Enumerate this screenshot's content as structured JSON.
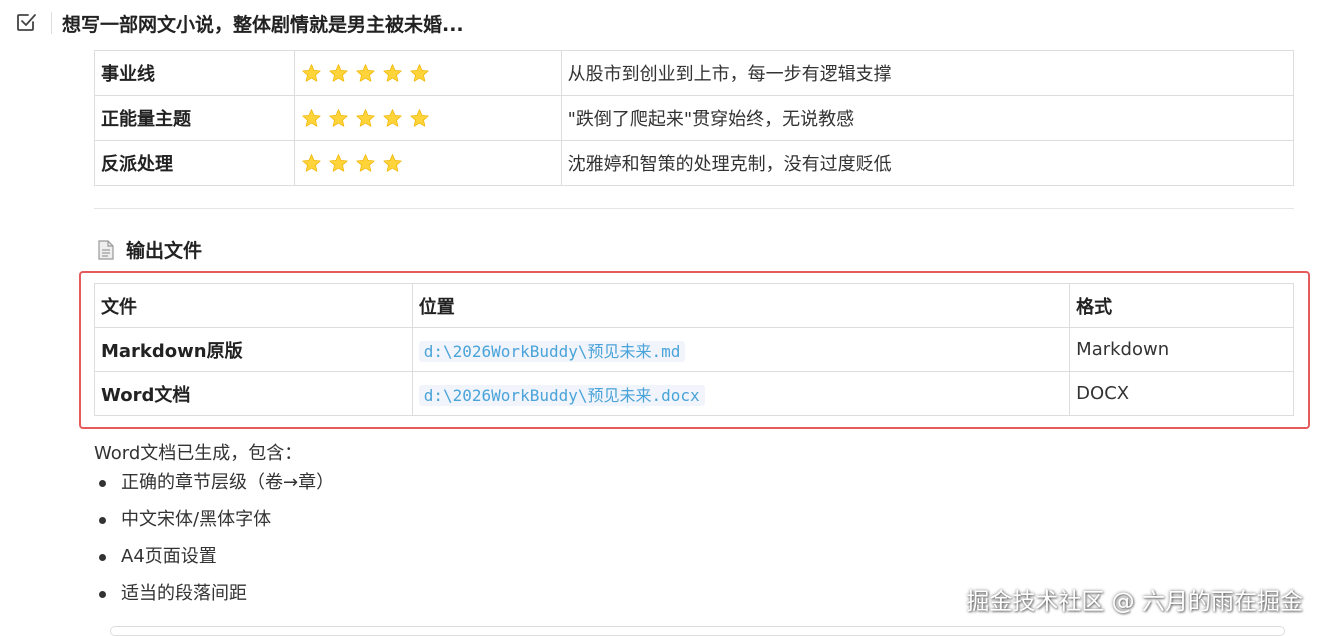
{
  "header": {
    "task_icon": "checkbox-icon",
    "title": "想写一部网文小说，整体剧情就是男主被未婚..."
  },
  "ratings": {
    "rows": [
      {
        "name": "事业线",
        "stars": 5,
        "comment": "从股市到创业到上市，每一步有逻辑支撑"
      },
      {
        "name": "正能量主题",
        "stars": 5,
        "comment": "\"跌倒了爬起来\"贯穿始终，无说教感"
      },
      {
        "name": "反派处理",
        "stars": 4,
        "comment": "沈雅婷和智策的处理克制，没有过度贬低"
      }
    ],
    "star_icon": "star-icon",
    "star_color": "#ffd43b"
  },
  "output": {
    "heading_icon": "document-icon",
    "heading": "输出文件",
    "columns": [
      "文件",
      "位置",
      "格式"
    ],
    "rows": [
      {
        "file": "Markdown原版",
        "path": "d:\\2026WorkBuddy\\预见未来.md",
        "format": "Markdown"
      },
      {
        "file": "Word文档",
        "path": "d:\\2026WorkBuddy\\预见未来.docx",
        "format": "DOCX"
      }
    ],
    "highlight_color": "#e55a5a"
  },
  "summary": {
    "intro": "Word文档已生成，包含：",
    "items": [
      "正确的章节层级（卷→章）",
      "中文宋体/黑体字体",
      "A4页面设置",
      "适当的段落间距"
    ]
  },
  "watermark": "掘金技术社区 @ 六月的雨在掘金"
}
